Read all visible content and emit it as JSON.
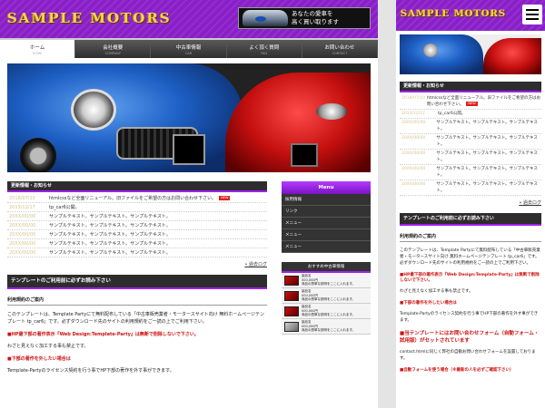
{
  "site": {
    "logo": "SAMPLE MOTORS",
    "banner_text_line1": "あなたの愛車を",
    "banner_text_line2": "高く買い取ります"
  },
  "gnav": [
    {
      "label": "ホーム",
      "sub": "HOME",
      "active": true
    },
    {
      "label": "会社概要",
      "sub": "COMPANY",
      "active": false
    },
    {
      "label": "中古車情報",
      "sub": "CAR",
      "active": false
    },
    {
      "label": "よく頂く質問",
      "sub": "FAQ",
      "active": false
    },
    {
      "label": "お問い合わせ",
      "sub": "CONTACT",
      "active": false
    }
  ],
  "news": {
    "heading": "更新情報・お知らせ",
    "items": [
      {
        "date": "2018/07/10",
        "text": "htmlcssなど全面リニューアル。旧ファイルをご希望の方はお問い合わせ下さい。",
        "new": true
      },
      {
        "date": "2013/12/17",
        "text": "tp_car6公開。",
        "new": false
      },
      {
        "date": "20XX/00/00",
        "text": "サンプルテキスト。サンプルテキスト。サンプルテキスト。",
        "new": false
      },
      {
        "date": "20XX/00/00",
        "text": "サンプルテキスト。サンプルテキスト。サンプルテキスト。",
        "new": false
      },
      {
        "date": "20XX/00/00",
        "text": "サンプルテキスト。サンプルテキスト。サンプルテキスト。",
        "new": false
      },
      {
        "date": "20XX/00/00",
        "text": "サンプルテキスト。サンプルテキスト。サンプルテキスト。",
        "new": false
      },
      {
        "date": "20XX/00/00",
        "text": "サンプルテキスト。サンプルテキスト。サンプルテキスト。",
        "new": false
      }
    ],
    "new_label": "NEW",
    "more_link": "» 過去ログ"
  },
  "notice": {
    "heading": "テンプレートのご利用前に必ずお読み下さい",
    "terms_heading": "利用規約のご案内",
    "body": "このテンプレートは、Template Partyにて無料配布している「中古車販売業者・モータースサイト向け 無料ホームページテンプレート tp_car6」です。必ずダウンロード先のサイトの利用規約をご一読の上でご利用下さい。",
    "link_text": "Template Party",
    "red1": "■HP最下部の著作表示『Web Design:Template-Party』は無断で削除しないで下さい。",
    "red1_note": "わざと見えなく加工する事も禁止です。",
    "red2": "■下部の著作を外したい場合は",
    "red2_note": "Template-Partyのライセンス契約を行う事でHP下部の著作を外す事ができます。",
    "warn": "■当テンプレートにはお問い合わせフォーム（自動フォーム・試用版）がセットされています",
    "contact_note": "contact.htmlに同じく弊社の自動お問い合わせフォームを設置しております。",
    "auto_form": "■自動フォームを使う場合（※最新の人を必ずご確認下さい）"
  },
  "side_menu": {
    "heading": "Menu",
    "items": [
      "採用情報",
      "リンク",
      "メニュー",
      "メニュー",
      "メニュー"
    ]
  },
  "pickup": {
    "heading": "おすすめ中古車情報",
    "items": [
      {
        "l1": "製品名",
        "l2": "000,000円",
        "l3": "商品の簡単な説明をここに入れます。"
      },
      {
        "l1": "製品名",
        "l2": "000,000円",
        "l3": "商品の簡単な説明をここに入れます。"
      },
      {
        "l1": "製品名",
        "l2": "000,000円",
        "l3": "商品の簡単な説明をここに入れます。"
      },
      {
        "l1": "製品名",
        "l2": "000,000円",
        "l3": "商品の簡単な説明をここに入れます。"
      }
    ]
  },
  "sp": {
    "news_items": [
      {
        "date": "2018/07/10",
        "text": "htmlcssなど全面リニューアル。旧ファイルをご希望の方はお問い合わせ下さい。",
        "new": true
      },
      {
        "date": "2013/12/17",
        "text": "tp_car6公開。",
        "new": false
      },
      {
        "date": "20XX/00/00",
        "text": "サンプルテキスト。サンプルテキスト。サンプルテキスト。",
        "new": false
      },
      {
        "date": "20XX/00/00",
        "text": "サンプルテキスト。サンプルテキスト。サンプルテキスト。",
        "new": false
      },
      {
        "date": "20XX/00/00",
        "text": "サンプルテキスト。サンプルテキスト。サンプルテキスト。",
        "new": false
      },
      {
        "date": "20XX/00/00",
        "text": "サンプルテキスト。サンプルテキスト。サンプルテキスト。",
        "new": false
      },
      {
        "date": "20XX/00/00",
        "text": "サンプルテキスト。サンプルテキスト。サンプルテキスト。",
        "new": false
      }
    ]
  },
  "colors": {
    "brand_purple": "#8a1fc9",
    "logo_gold": "#f4d35a",
    "new_red": "#e02020"
  }
}
